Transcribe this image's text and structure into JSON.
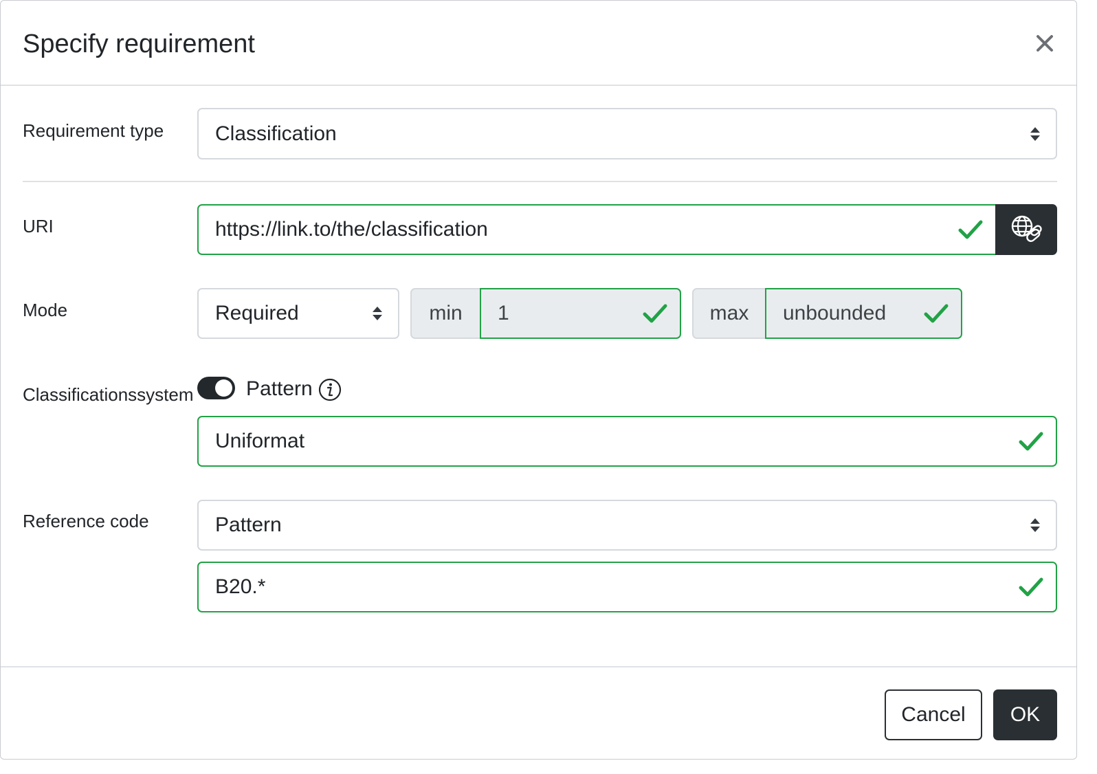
{
  "dialog": {
    "title": "Specify requirement"
  },
  "fields": {
    "requirement_type": {
      "label": "Requirement type",
      "value": "Classification"
    },
    "uri": {
      "label": "URI",
      "value": "https://link.to/the/classification"
    },
    "mode": {
      "label": "Mode",
      "value": "Required",
      "min_label": "min",
      "min_value": "1",
      "max_label": "max",
      "max_value": "unbounded"
    },
    "classification_system": {
      "label": "Classificationssystem",
      "pattern_toggle_label": "Pattern",
      "pattern_enabled": true,
      "value": "Uniformat"
    },
    "reference_code": {
      "label": "Reference code",
      "mode_value": "Pattern",
      "value": "B20.*"
    }
  },
  "footer": {
    "cancel_label": "Cancel",
    "ok_label": "OK"
  },
  "colors": {
    "valid": "#21a246",
    "dark": "#2a2f33",
    "addon_bg": "#e9ecef"
  },
  "icons": {
    "close": "close-icon",
    "select_arrows": "sort-arrows-icon",
    "valid": "check-icon",
    "link": "globe-link-icon",
    "info": "info-icon"
  }
}
